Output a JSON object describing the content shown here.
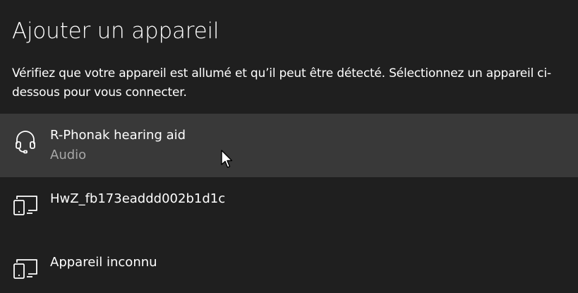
{
  "dialog": {
    "title": "Ajouter un appareil",
    "description": "Vérifiez que votre appareil est allumé et qu’il peut être détecté. Sélectionnez un appareil ci-dessous pour vous connecter."
  },
  "devices": [
    {
      "name": "R-Phonak hearing aid",
      "type": "Audio",
      "icon": "headset-icon",
      "selected": true
    },
    {
      "name": "HwZ_fb173eaddd002b1d1c",
      "type": "",
      "icon": "display-device-icon",
      "selected": false
    },
    {
      "name": "Appareil inconnu",
      "type": "",
      "icon": "display-device-icon",
      "selected": false
    }
  ],
  "colors": {
    "background": "#1f1f1f",
    "selected_row": "#393939",
    "secondary_text": "#a8a8a8"
  }
}
